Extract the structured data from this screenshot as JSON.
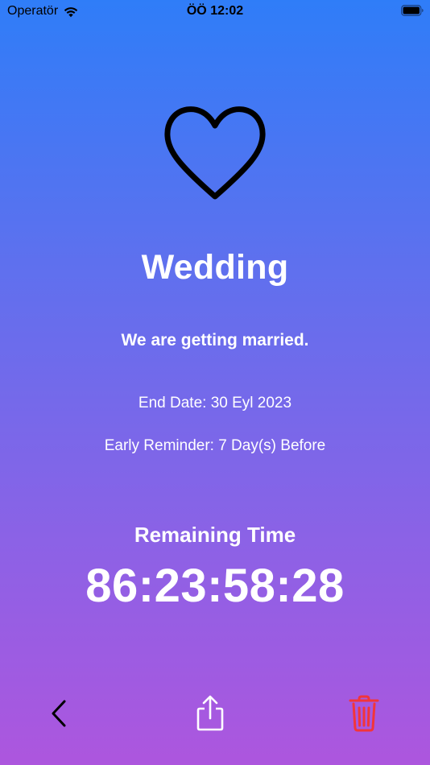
{
  "status_bar": {
    "carrier": "Operatör",
    "time": "ÖÖ 12:02",
    "icons": [
      "wifi-icon",
      "battery-icon"
    ]
  },
  "event": {
    "icon": "heart-icon",
    "title": "Wedding",
    "description": "We are getting married.",
    "end_date": "End Date: 30 Eyl 2023",
    "early_reminder": "Early Reminder: 7 Day(s) Before"
  },
  "countdown": {
    "label": "Remaining Time",
    "value": "86:23:58:28"
  },
  "toolbar": {
    "back_icon": "chevron-left-icon",
    "share_icon": "share-icon",
    "delete_icon": "trash-icon",
    "delete_color": "#f2353a"
  },
  "colors": {
    "gradient_top": "#2f7df8",
    "gradient_bottom": "#ad56de"
  }
}
